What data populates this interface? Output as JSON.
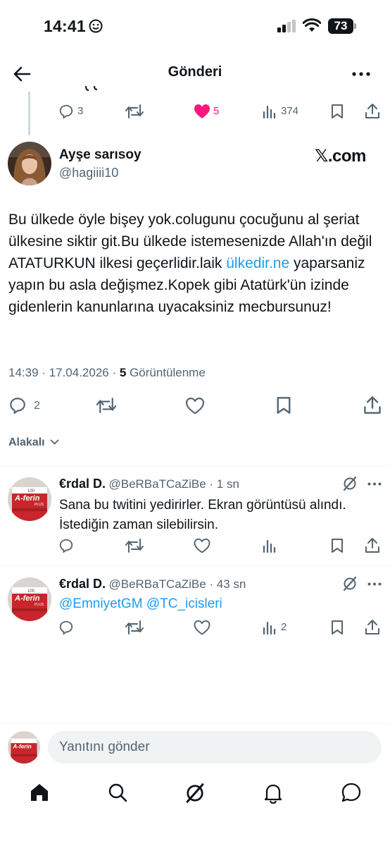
{
  "status_bar": {
    "time": "14:41",
    "battery": "73"
  },
  "header": {
    "title": "Gönderi"
  },
  "parent_tweet": {
    "replies": "3",
    "likes": "5",
    "views": "374"
  },
  "tweet": {
    "author_name": "Ayşe sarısoy",
    "author_handle": "@hagiiii10",
    "source_badge": "𝕏.com",
    "text_before_link": "Bu ülkede öyle bişey yok.colugunu çocuğunu al şeriat ülkesine siktir git.Bu ülkede istemesenizde Allah'ın değil ATATURKUN ilkesi geçerlidir.laik ",
    "text_link": "ülkedir.ne",
    "text_after_link": " yaparsaniz yapın bu asla değişmez.Kopek gibi Atatürk'ün izinde gidenlerin kanunlarına uyacaksiniz mecbursunuz!",
    "time": "14:39",
    "date": "17.04.2026",
    "views": "5",
    "views_label": "Görüntülenme",
    "reply_count": "2"
  },
  "related": {
    "label": "Alakalı"
  },
  "replies": [
    {
      "author_name": "€rdal D.",
      "author_handle": "@BeRBaTCaZiBe",
      "time": "1 sn",
      "text": "Sana bu twitini yedirirler. Ekran görüntüsü alındı. İstediğin zaman silebilirsin."
    },
    {
      "author_name": "€rdal D.",
      "author_handle": "@BeRBaTCaZiBe",
      "time": "43 sn",
      "mention_1": "@EmniyetGM",
      "mention_2": "@TC_icisleri",
      "views": "2"
    }
  ],
  "avatar_label": {
    "line1": "100",
    "line2": "A-ferin",
    "line3": "PLUS"
  },
  "compose": {
    "placeholder": "Yanıtını gönder"
  },
  "colors": {
    "accent": "#1d9bf0",
    "like": "#f91880",
    "muted": "#536471",
    "text": "#0f1419"
  },
  "icons": [
    "back-arrow-icon",
    "more-icon",
    "reply-icon",
    "retweet-icon",
    "like-icon",
    "views-icon",
    "bookmark-icon",
    "share-icon",
    "grok-icon",
    "home-icon",
    "search-icon",
    "notifications-icon",
    "messages-icon"
  ]
}
